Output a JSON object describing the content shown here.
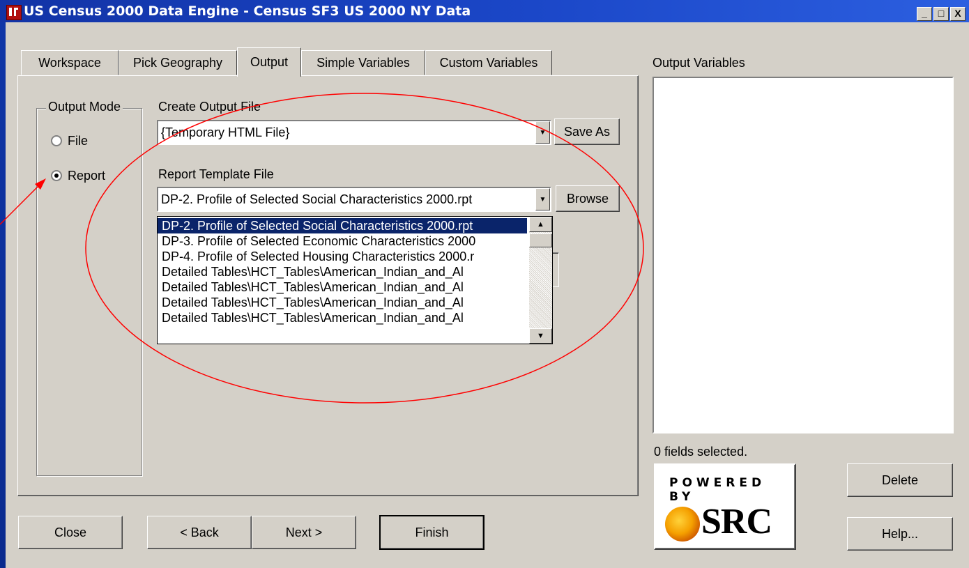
{
  "window": {
    "title": "US Census 2000 Data Engine - Census SF3 US 2000 NY Data"
  },
  "window_buttons": {
    "minimize": "_",
    "maximize": "□",
    "close": "X"
  },
  "tabs": [
    "Workspace",
    "Pick Geography",
    "Output",
    "Simple Variables",
    "Custom Variables"
  ],
  "active_tab": "Output",
  "output_mode": {
    "label": "Output Mode",
    "options": [
      "File",
      "Report"
    ],
    "selected": "Report"
  },
  "create_output": {
    "label": "Create Output File",
    "value": "{Temporary HTML File}",
    "save_as": "Save As"
  },
  "report_template": {
    "label": "Report Template File",
    "value": "DP-2. Profile of Selected Social Characteristics 2000.rpt",
    "browse": "Browse",
    "options": [
      "DP-2. Profile of Selected Social Characteristics 2000.rpt",
      "DP-3. Profile of Selected Economic Characteristics 2000",
      "DP-4. Profile of Selected Housing Characteristics 2000.r",
      "Detailed Tables\\HCT_Tables\\American_Indian_and_Al",
      "Detailed Tables\\HCT_Tables\\American_Indian_and_Al",
      "Detailed Tables\\HCT_Tables\\American_Indian_and_Al",
      "Detailed Tables\\HCT_Tables\\American_Indian_and_Al"
    ],
    "selected_index": 0
  },
  "output_variables": {
    "label": "Output Variables",
    "status": "0 fields selected."
  },
  "buttons": {
    "close": "Close",
    "back": "< Back",
    "next": "Next >",
    "finish": "Finish",
    "delete": "Delete",
    "help": "Help..."
  },
  "logo": {
    "powered_by": "POWERED BY",
    "brand": "SRC"
  },
  "colors": {
    "titlebar": "#1b47c8",
    "dialog_bg": "#d4d0c8",
    "selection": "#0a246a",
    "annotation": "#ff0000"
  }
}
